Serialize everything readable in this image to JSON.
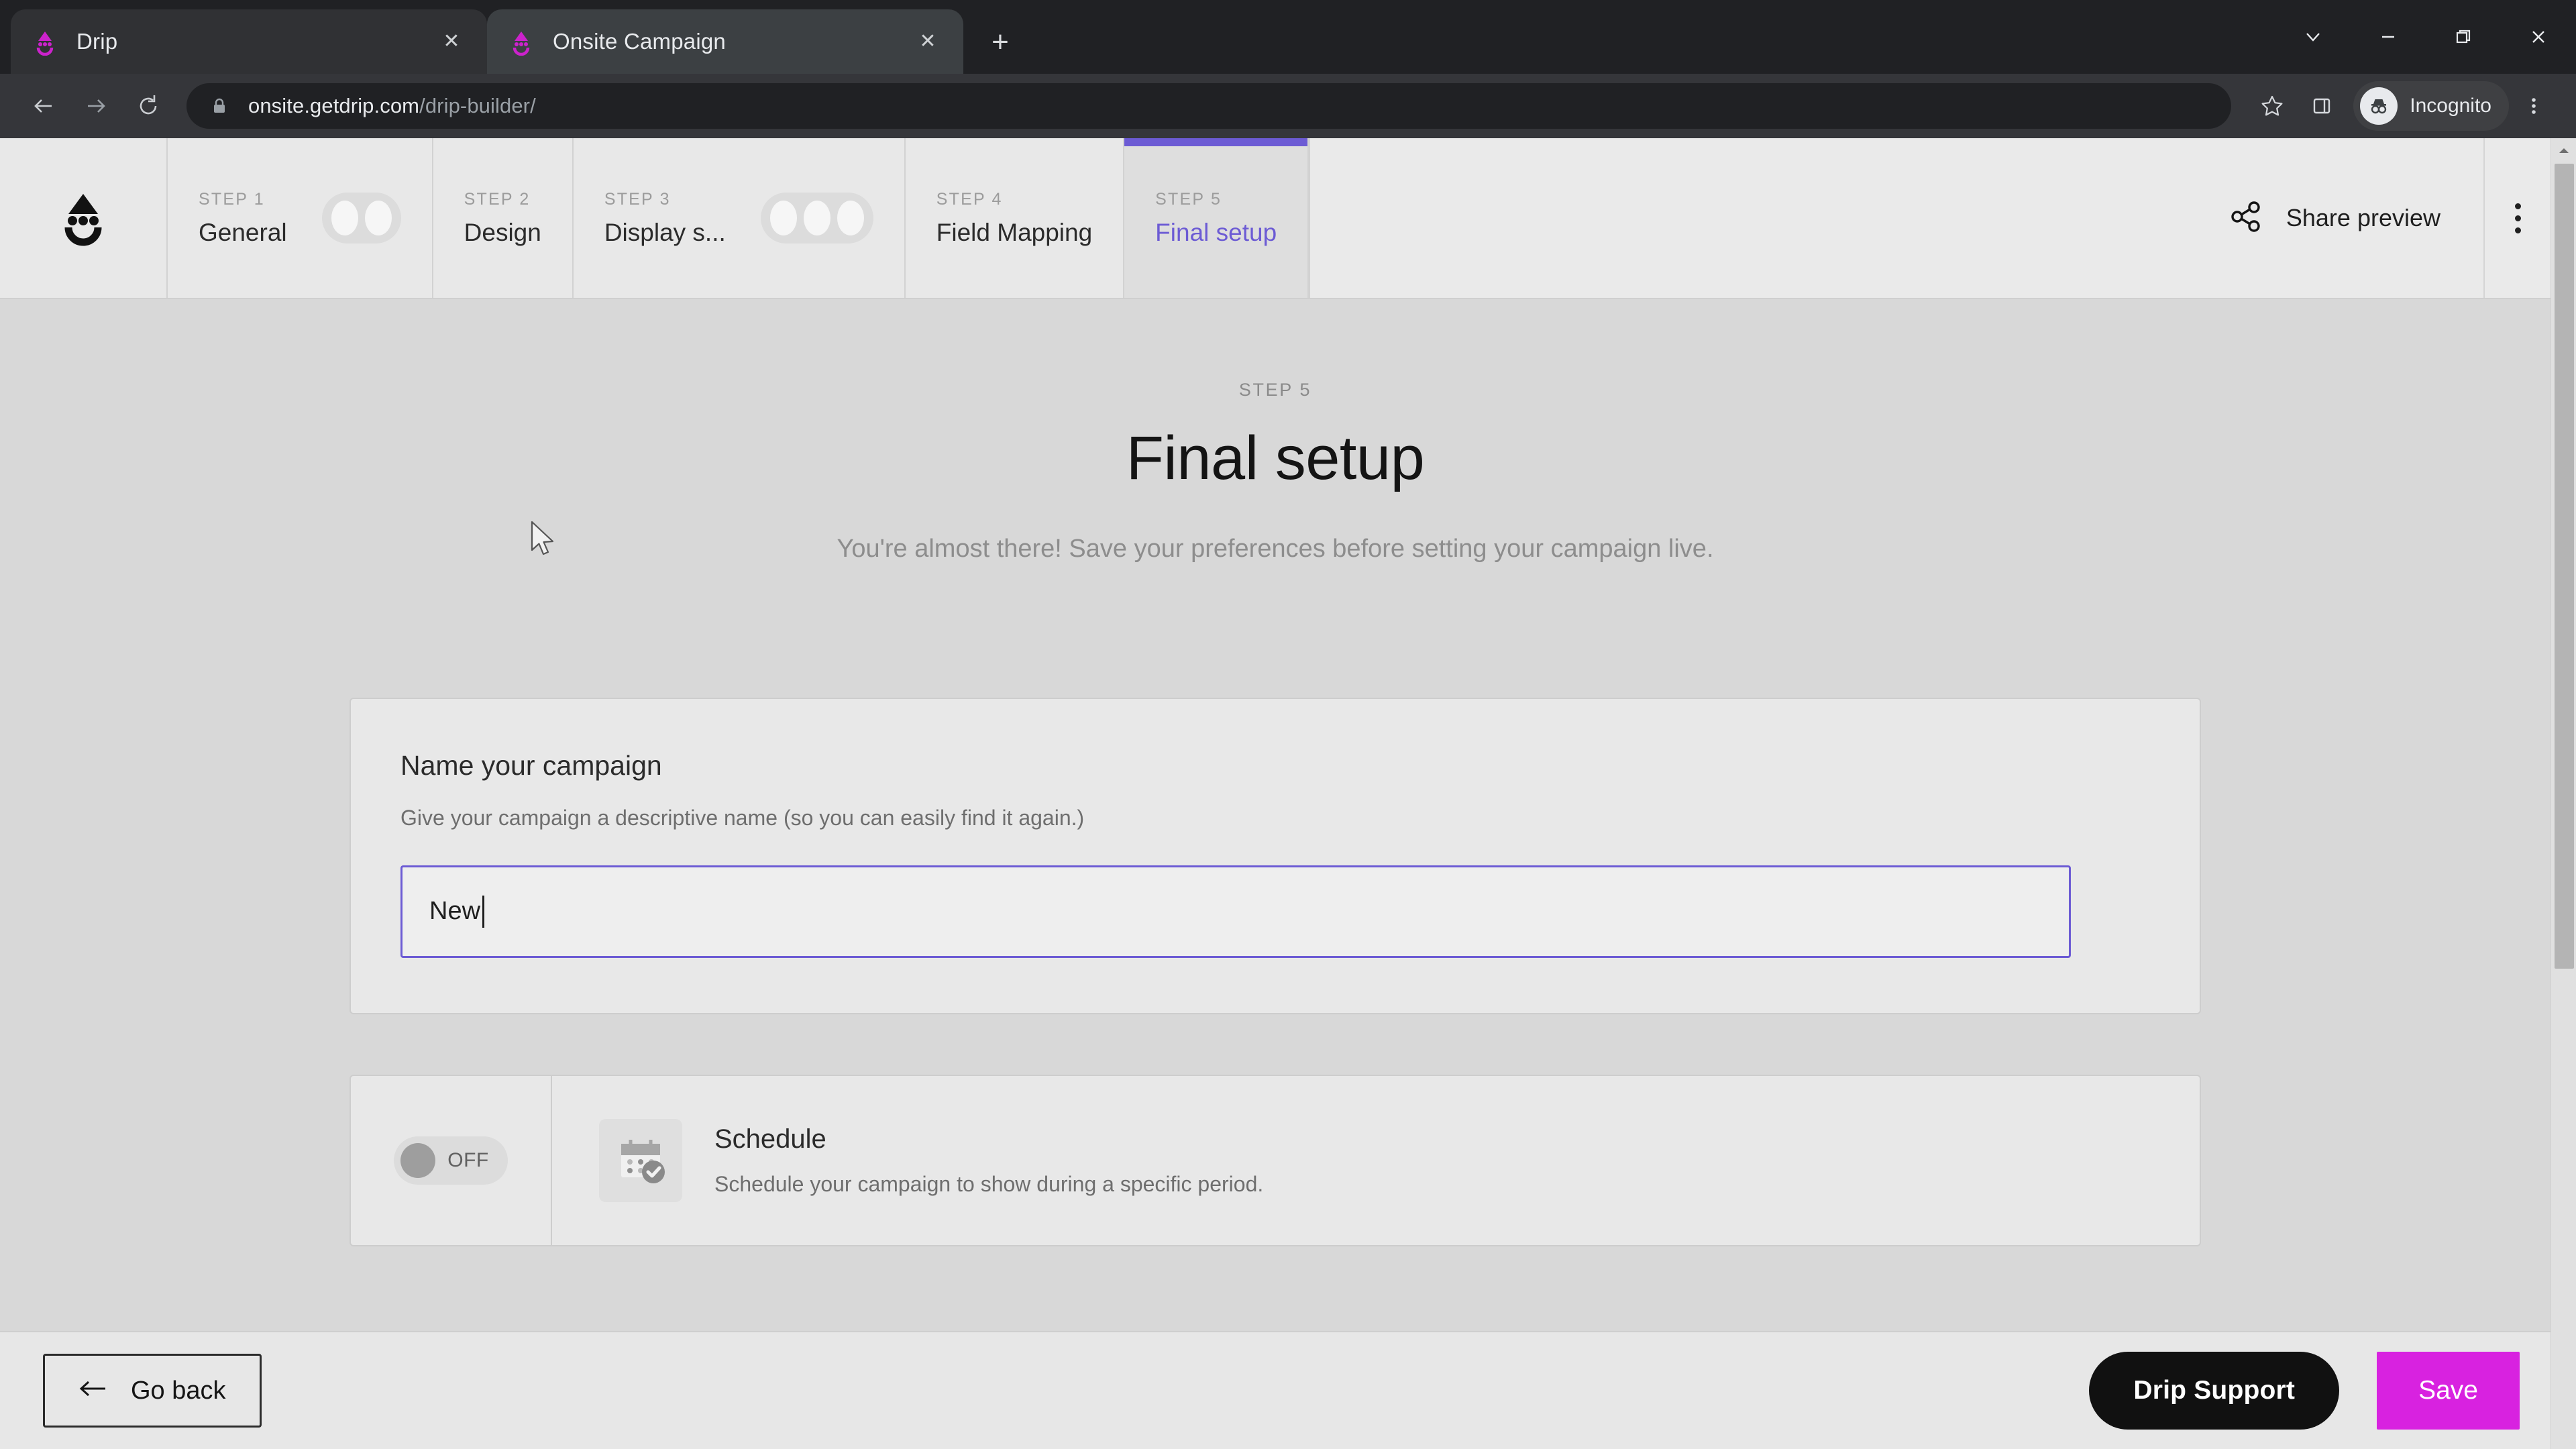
{
  "browser": {
    "tabs": [
      {
        "title": "Drip",
        "favicon": "drip-logo-icon",
        "active": false
      },
      {
        "title": "Onsite Campaign",
        "favicon": "drip-logo-icon",
        "active": true
      }
    ],
    "new_tab_label": "+",
    "close_label": "✕",
    "window_controls": [
      {
        "name": "chevron-down-icon",
        "glyph": "⌄"
      },
      {
        "name": "minimize-icon",
        "glyph": "–"
      },
      {
        "name": "restore-icon",
        "glyph": "❐"
      },
      {
        "name": "close-window-icon",
        "glyph": "✕"
      }
    ],
    "url_domain": "onsite.getdrip.com",
    "url_path": "/drip-builder/",
    "profile_label": "Incognito",
    "back_icon": "back-arrow-icon",
    "forward_icon": "forward-arrow-icon",
    "reload_icon": "reload-icon",
    "lock_icon": "lock-icon",
    "bookmark_icon": "star-icon",
    "side_panel_icon": "side-panel-icon",
    "menu_icon": "browser-menu-icon"
  },
  "stepbar": {
    "logo": "drip-logo-icon",
    "steps": [
      {
        "kicker": "STEP 1",
        "name": "General",
        "pill_dots": 2,
        "active": false
      },
      {
        "kicker": "STEP 2",
        "name": "Design",
        "pill_dots": 0,
        "active": false
      },
      {
        "kicker": "STEP 3",
        "name": "Display s...",
        "pill_dots": 3,
        "active": false
      },
      {
        "kicker": "STEP 4",
        "name": "Field Mapping",
        "pill_dots": 0,
        "active": false
      },
      {
        "kicker": "STEP 5",
        "name": "Final setup",
        "pill_dots": 0,
        "active": true
      }
    ],
    "share_label": "Share preview",
    "share_icon": "share-network-icon",
    "overflow_icon": "kebab-menu-icon",
    "active_color": "#6c5bd4"
  },
  "hero": {
    "kicker": "STEP 5",
    "title": "Final setup",
    "subtitle": "You're almost there! Save your preferences before setting your campaign live."
  },
  "name_card": {
    "title": "Name your campaign",
    "description": "Give your campaign a descriptive name (so you can easily find it again.)",
    "input_value": "New",
    "input_placeholder": "",
    "focus_color": "#6c5bd4"
  },
  "schedule_card": {
    "toggle_state": "OFF",
    "toggle_on": false,
    "icon": "calendar-check-icon",
    "title": "Schedule",
    "description": "Schedule your campaign to show during a specific period."
  },
  "footer": {
    "go_back_label": "Go back",
    "go_back_icon": "left-arrow-icon",
    "support_label": "Drip Support",
    "save_label": "Save",
    "save_color": "#d822e0"
  }
}
